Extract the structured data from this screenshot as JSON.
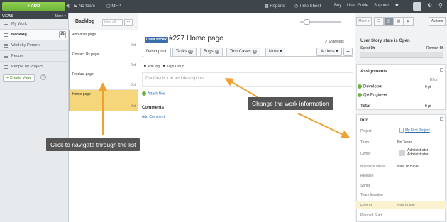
{
  "topbar": {
    "add_label": "+ ADD",
    "team_label": "No team",
    "project_label": "MFP",
    "reports": "Reports",
    "timesheet": "Time Sheet",
    "buy": "Buy",
    "user_guide": "User Guide",
    "support": "Support"
  },
  "sidebar": {
    "views_label": "VIEWS",
    "more_label": "More ▾",
    "items": [
      {
        "label": "My Work"
      },
      {
        "label": "Backlog"
      },
      {
        "label": "Work by Person"
      },
      {
        "label": "People"
      },
      {
        "label": "People by Project"
      }
    ],
    "create_view": "+ Create View",
    "help": "?"
  },
  "backlog": {
    "title": "Backlog",
    "filter_placeholder": "filter off",
    "more_dots": "...",
    "cards": [
      {
        "title": "About Us page",
        "points": "0pt"
      },
      {
        "title": "Contact Us page",
        "points": "0pt"
      },
      {
        "title": "Product page",
        "points": "0pt"
      },
      {
        "title": "Home page",
        "points": "0pt"
      }
    ]
  },
  "story": {
    "type_badge": "USER STORY",
    "id": "#227",
    "name": "Home page",
    "share_link": "Share link",
    "tabs": [
      {
        "label": "Description"
      },
      {
        "label": "Tasks",
        "count": "0"
      },
      {
        "label": "Bugs",
        "count": "0"
      },
      {
        "label": "Test Cases",
        "count": "0"
      },
      {
        "label": "More ▾"
      }
    ],
    "actions": "Actions ▾",
    "plus": "+",
    "add_tag": "Add tag",
    "tags_cloud": "Tags Cloud",
    "description_placeholder": "Double-click to add description...",
    "attach_files": "Attach files",
    "comments_title": "Comments",
    "add_comment": "Add Comment"
  },
  "toolbar": {
    "more_label": "More ▾",
    "actions_label": "Actions"
  },
  "state": {
    "prefix": "User Story state is ",
    "value": "Open",
    "spent_label": "Spent",
    "spent_value": "0h",
    "remain_label": "Remain",
    "remain_value": "0h"
  },
  "assignments": {
    "title": "Assignments",
    "effort_header": "Effort",
    "roles": [
      {
        "name": "Developer",
        "effort": "0 pt"
      },
      {
        "name": "QA Engineer",
        "effort": ""
      }
    ],
    "total_label": "Total",
    "total_value": "0 pt"
  },
  "info": {
    "title": "Info",
    "rows": [
      {
        "label": "Project",
        "value": "My First Project"
      },
      {
        "label": "Team",
        "value": "No Team"
      },
      {
        "label": "Owner",
        "value": "Administrator Administrator"
      },
      {
        "label": "Business Value",
        "value": "Nice To Have"
      },
      {
        "label": "Release",
        "value": ""
      },
      {
        "label": "Sprint",
        "value": ""
      },
      {
        "label": "Team Iteration",
        "value": ""
      },
      {
        "label": "Feature",
        "value": "click to edit"
      },
      {
        "label": "Planned Start",
        "value": ""
      }
    ]
  },
  "tooltips": {
    "navigate": "Click to navigate through the list",
    "change": "Change the work information"
  },
  "colors": {
    "accent_green": "#7ac143",
    "arrow_orange": "#f0a030",
    "selected_card": "#f5d67a",
    "badge_blue": "#3a6eaa",
    "link_blue": "#2f6db5"
  }
}
